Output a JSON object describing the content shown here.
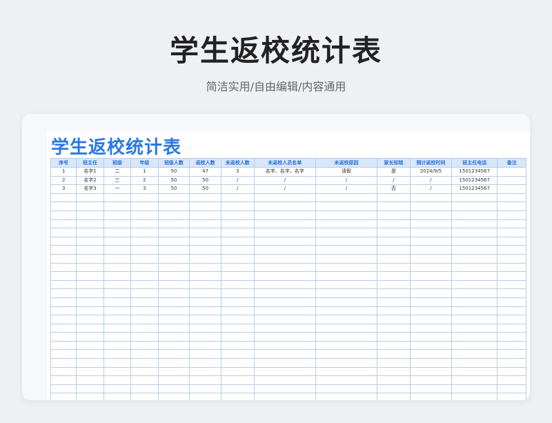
{
  "header": {
    "title": "学生返校统计表",
    "subtitle": "简洁实用/自由编辑/内容通用"
  },
  "sheet": {
    "title": "学生返校统计表",
    "columns": [
      "序号",
      "班主任",
      "班级",
      "年级",
      "班级人数",
      "返校人数",
      "未返校人数",
      "未返校人员名单",
      "未返校原因",
      "家长知晓",
      "预计返校时间",
      "班主任电话",
      "备注"
    ],
    "rows": [
      [
        "1",
        "名字1",
        "二",
        "1",
        "50",
        "47",
        "3",
        "名字、名字、名字",
        "请假",
        "是",
        "2024/9/5",
        "1501234567",
        ""
      ],
      [
        "2",
        "名字2",
        "三",
        "2",
        "50",
        "50",
        "/",
        "/",
        "/",
        "/",
        "/",
        "1501234567",
        ""
      ],
      [
        "3",
        "名字3",
        "一",
        "3",
        "50",
        "50",
        "/",
        "/",
        "/",
        "否",
        "/",
        "1501234567",
        ""
      ]
    ],
    "empty_row_count": 26
  },
  "colors": {
    "accent": "#2a78e4",
    "header_bg": "#d8e7fb",
    "grid_line": "#b7cbe6"
  }
}
